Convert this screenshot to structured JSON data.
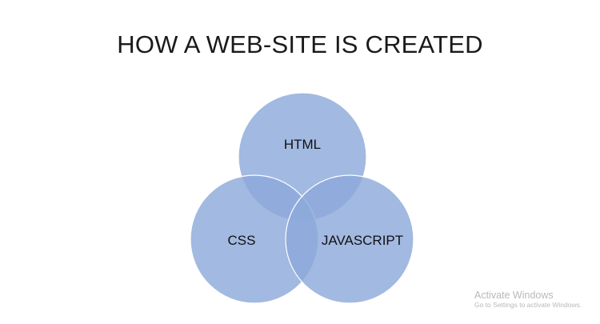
{
  "slide": {
    "title": "HOW A WEB-SITE IS CREATED"
  },
  "venn": {
    "fill_color": "#8EA9DB",
    "overlap_color": "#6E8ECF",
    "circles": [
      {
        "id": "html",
        "label": "HTML"
      },
      {
        "id": "css",
        "label": "CSS"
      },
      {
        "id": "javascript",
        "label": "JAVASCRIPT"
      }
    ]
  },
  "watermark": {
    "title": "Activate Windows",
    "subtitle": "Go to Settings to activate Windows."
  }
}
